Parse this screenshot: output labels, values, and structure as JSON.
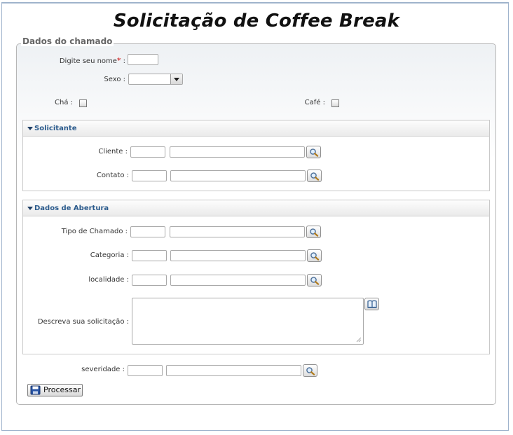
{
  "title": "Solicitação de Coffee Break",
  "fieldset": {
    "legend": "Dados do chamado",
    "nome_label": "Digite seu nome",
    "nome_required": "*",
    "nome_sep": " :",
    "nome_value": "",
    "sexo_label": "Sexo :",
    "sexo_value": "",
    "cha_label": "Chá :",
    "cafe_label": "Café :"
  },
  "solicitante": {
    "title": "Solicitante",
    "cliente_label": "Cliente :",
    "contato_label": "Contato :"
  },
  "abertura": {
    "title": "Dados de Abertura",
    "tipo_label": "Tipo de Chamado :",
    "categoria_label": "Categoria :",
    "localidade_label": "localidade :",
    "descricao_label": "Descreva sua solicitação :"
  },
  "severidade_label": "severidade :",
  "process_button": "Processar",
  "icons": {
    "search": "magnifier-icon",
    "book": "book-icon",
    "save": "floppy-icon",
    "collapse": "triangle-down-icon"
  },
  "colors": {
    "panel_title": "#2a5a8c",
    "required": "#cc0000"
  }
}
